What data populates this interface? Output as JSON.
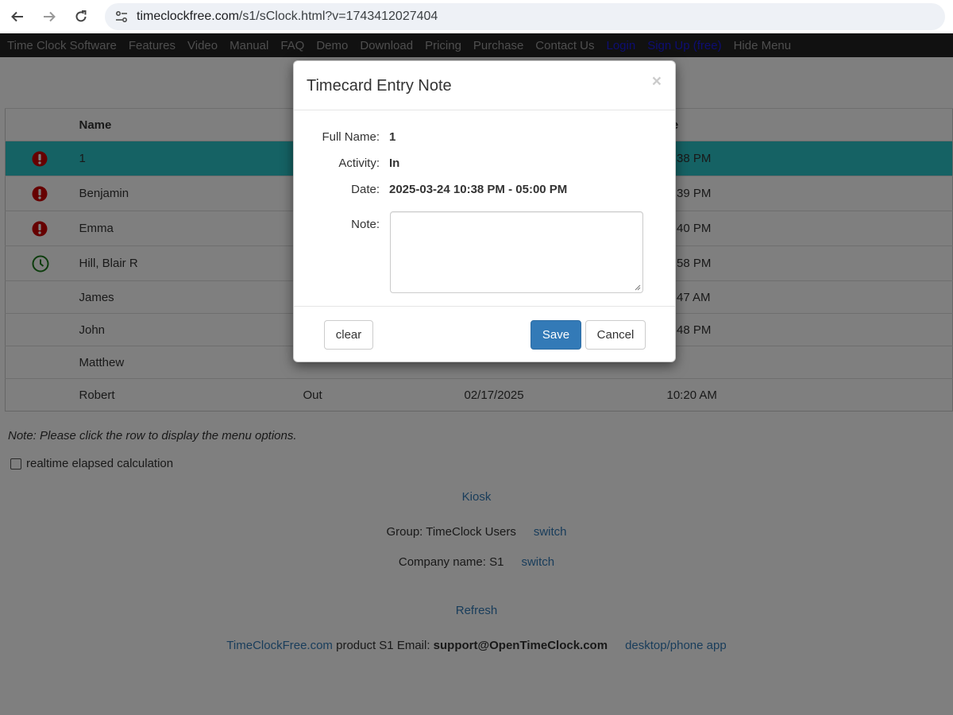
{
  "browser": {
    "url_host": "timeclockfree.com",
    "url_path": "/s1/sClock.html?v=1743412027404"
  },
  "site_nav": {
    "items": [
      "Time Clock Software",
      "Features",
      "Video",
      "Manual",
      "FAQ",
      "Demo",
      "Download",
      "Pricing",
      "Purchase",
      "Contact Us",
      "Login",
      "Sign Up (free)",
      "Hide Menu"
    ]
  },
  "table": {
    "headers": {
      "name": "Name",
      "time_tail": "me"
    },
    "rows": [
      {
        "name": "1",
        "activity": "",
        "date": "",
        "time": "0:38 PM",
        "icon": "alert-icon"
      },
      {
        "name": "Benjamin",
        "activity": "",
        "date": "",
        "time": "0:39 PM",
        "icon": "alert-icon"
      },
      {
        "name": "Emma",
        "activity": "",
        "date": "",
        "time": "0:40 PM",
        "icon": "alert-icon"
      },
      {
        "name": "Hill, Blair R",
        "activity": "",
        "date": "",
        "time": "0:58 PM",
        "icon": "clock-icon"
      },
      {
        "name": "James",
        "activity": "",
        "date": "",
        "time": "6:47 AM",
        "icon": ""
      },
      {
        "name": "John",
        "activity": "",
        "date": "",
        "time": "4:48 PM",
        "icon": ""
      },
      {
        "name": "Matthew",
        "activity": "",
        "date": "",
        "time": "",
        "icon": ""
      },
      {
        "name": "Robert",
        "activity": "Out",
        "date": "02/17/2025",
        "time": "10:20 AM",
        "icon": ""
      }
    ]
  },
  "page": {
    "note": "Note: Please click the row to display the menu options.",
    "realtime_label": "realtime elapsed calculation",
    "kiosk": "Kiosk",
    "group_label": "Group: TimeClock Users",
    "switch": "switch",
    "company_label": "Company name: S1",
    "refresh": "Refresh",
    "footer_site": "TimeClockFree.com",
    "footer_product": " product S1 Email: ",
    "footer_email": "support@OpenTimeClock.com",
    "footer_app": "desktop/phone app"
  },
  "modal": {
    "title": "Timecard Entry Note",
    "close": "×",
    "full_name_label": "Full Name:",
    "full_name_value": "1",
    "activity_label": "Activity:",
    "activity_value": "In",
    "date_label": "Date:",
    "date_value": "2025-03-24 10:38 PM - 05:00 PM",
    "note_label": "Note:",
    "note_value": "",
    "clear_label": "clear",
    "save_label": "Save",
    "cancel_label": "Cancel"
  },
  "colors": {
    "selected_row": "#2ac4c8",
    "alert_icon": "#cc0000",
    "clock_icon": "#1a7a1a",
    "primary": "#337ab7",
    "nav_bg": "#222222"
  }
}
